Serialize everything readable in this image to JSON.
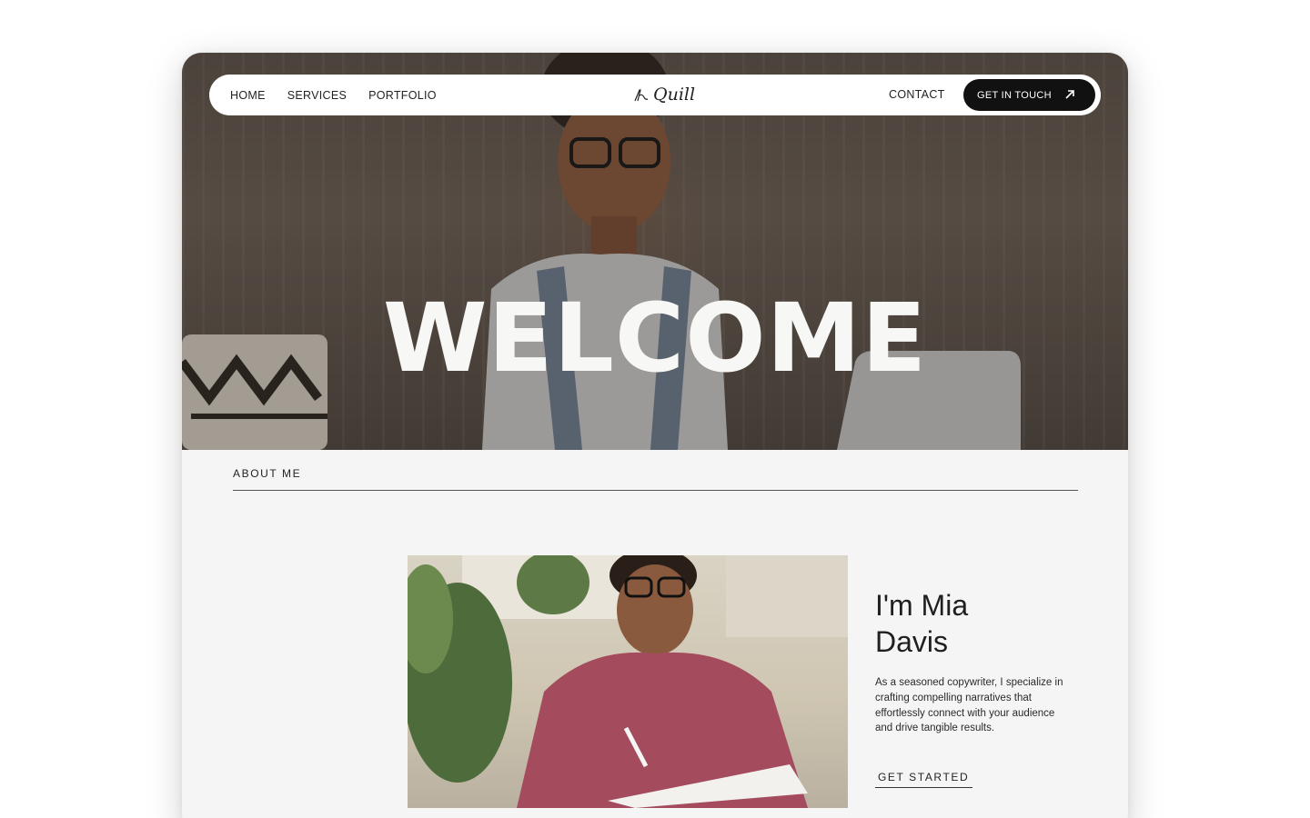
{
  "nav": {
    "links": [
      {
        "label": "HOME"
      },
      {
        "label": "SERVICES"
      },
      {
        "label": "PORTFOLIO"
      }
    ],
    "logo_text": "Quill",
    "contact_label": "CONTACT",
    "cta_label": "GET IN TOUCH",
    "cta_icon": "arrow-up-right-icon"
  },
  "hero": {
    "title": "WELCOME"
  },
  "about": {
    "section_label": "ABOUT ME",
    "heading_line1": "I'm Mia",
    "heading_line2": "Davis",
    "body": "As a seasoned copywriter, I specialize in crafting compelling narratives that effortlessly connect with your audience and drive tangible results.",
    "cta_label": "GET STARTED"
  },
  "colors": {
    "page_bg": "#ffffff",
    "card_bg": "#f5f5f5",
    "nav_bg": "#ffffff",
    "cta_bg": "#111111",
    "hero_text": "#f7f7f5"
  }
}
